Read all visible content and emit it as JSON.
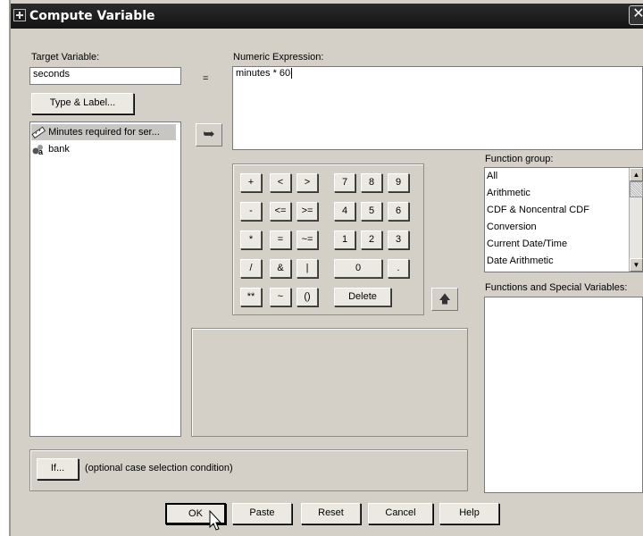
{
  "window": {
    "title": "Compute Variable",
    "close_glyph": "✕"
  },
  "target": {
    "label": "Target Variable:",
    "value": "seconds",
    "equals": "=",
    "type_label_button": "Type & Label..."
  },
  "expression": {
    "label": "Numeric Expression:",
    "value": "minutes * 60"
  },
  "variables": [
    {
      "icon": "scale-variable-icon",
      "label": "Minutes required for ser..."
    },
    {
      "icon": "nominal-variable-icon",
      "label": "bank"
    }
  ],
  "transfer_arrow_glyph": "➥",
  "keypad": {
    "rows": [
      [
        "+",
        "<",
        ">",
        "7",
        "8",
        "9"
      ],
      [
        "-",
        "<=",
        ">=",
        "4",
        "5",
        "6"
      ],
      [
        "*",
        "=",
        "~=",
        "1",
        "2",
        "3"
      ],
      [
        "/",
        "&",
        "|",
        "0",
        "."
      ],
      [
        "**",
        "~",
        "()",
        "Delete"
      ]
    ]
  },
  "up_arrow_glyph": "🡅",
  "function_group": {
    "label": "Function group:",
    "items": [
      "All",
      "Arithmetic",
      "CDF & Noncentral CDF",
      "Conversion",
      "Current Date/Time",
      "Date Arithmetic"
    ]
  },
  "functions": {
    "label": "Functions and Special Variables:"
  },
  "if": {
    "button": "If...",
    "text": "(optional case selection condition)"
  },
  "buttons": {
    "ok": "OK",
    "paste": "Paste",
    "reset": "Reset",
    "cancel": "Cancel",
    "help": "Help"
  }
}
